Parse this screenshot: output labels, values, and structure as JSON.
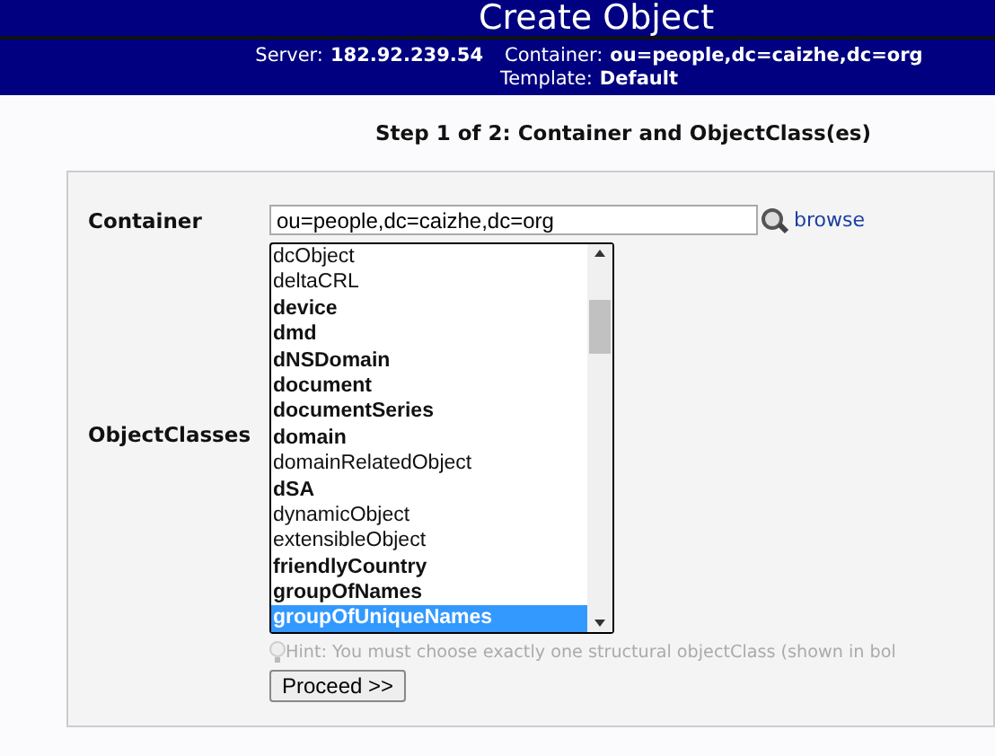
{
  "page_title": "Create Object",
  "info": {
    "server_label": "Server:",
    "server": "182.92.239.54",
    "container_label": "Container:",
    "container": "ou=people,dc=caizhe,dc=org",
    "template_label": "Template:",
    "template": "Default"
  },
  "step_heading": "Step 1 of 2: Container and ObjectClass(es)",
  "container_field": {
    "label": "Container",
    "value": "ou=people,dc=caizhe,dc=org",
    "browse": "browse"
  },
  "objectclasses": {
    "label": "ObjectClasses",
    "items": [
      {
        "name": "dcObject",
        "structural": false,
        "selected": false
      },
      {
        "name": "deltaCRL",
        "structural": false,
        "selected": false
      },
      {
        "name": "device",
        "structural": true,
        "selected": false
      },
      {
        "name": "dmd",
        "structural": true,
        "selected": false
      },
      {
        "name": "dNSDomain",
        "structural": true,
        "selected": false
      },
      {
        "name": "document",
        "structural": true,
        "selected": false
      },
      {
        "name": "documentSeries",
        "structural": true,
        "selected": false
      },
      {
        "name": "domain",
        "structural": true,
        "selected": false
      },
      {
        "name": "domainRelatedObject",
        "structural": false,
        "selected": false
      },
      {
        "name": "dSA",
        "structural": true,
        "selected": false
      },
      {
        "name": "dynamicObject",
        "structural": false,
        "selected": false
      },
      {
        "name": "extensibleObject",
        "structural": false,
        "selected": false
      },
      {
        "name": "friendlyCountry",
        "structural": true,
        "selected": false
      },
      {
        "name": "groupOfNames",
        "structural": true,
        "selected": false
      },
      {
        "name": "groupOfUniqueNames",
        "structural": true,
        "selected": true
      }
    ]
  },
  "hint": "Hint: You must choose exactly one structural objectClass (shown in bol",
  "proceed_button": "Proceed >>"
}
